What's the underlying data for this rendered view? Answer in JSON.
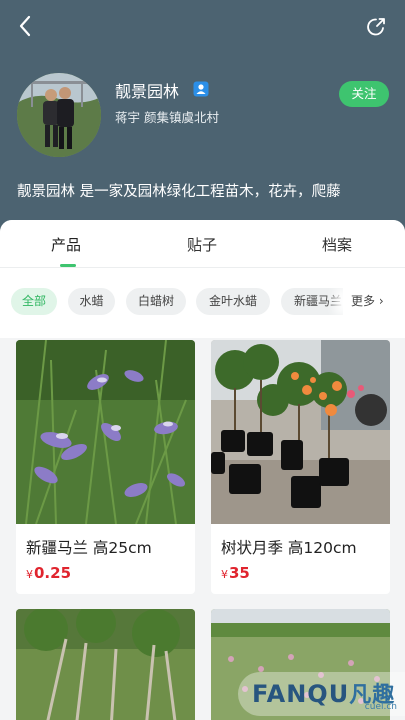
{
  "header": {
    "shop_name": "靓景园林",
    "owner_location": "蒋宇 颜集镇虞北村",
    "follow_label": "关注",
    "intro": "靓景园林 是一家及园林绿化工程苗木，花卉，爬藤"
  },
  "tabs": [
    {
      "label": "产品",
      "active": true
    },
    {
      "label": "贴子",
      "active": false
    },
    {
      "label": "档案",
      "active": false
    }
  ],
  "categories": {
    "items": [
      "全部",
      "水蜡",
      "白蜡树",
      "金叶水蜡",
      "新疆马兰"
    ],
    "active_index": 0,
    "more_label": "更多"
  },
  "products": [
    {
      "title": "新疆马兰 高25cm",
      "currency": "¥",
      "price": "0.25"
    },
    {
      "title": "树状月季 高120cm",
      "currency": "¥",
      "price": "35"
    }
  ],
  "watermark": {
    "brand": "FANQU",
    "brand_cn": "凡趣",
    "url": "cuel.cn"
  },
  "colors": {
    "header_bg": "#4c6371",
    "accent": "#3ec46f",
    "price": "#e0242e"
  }
}
